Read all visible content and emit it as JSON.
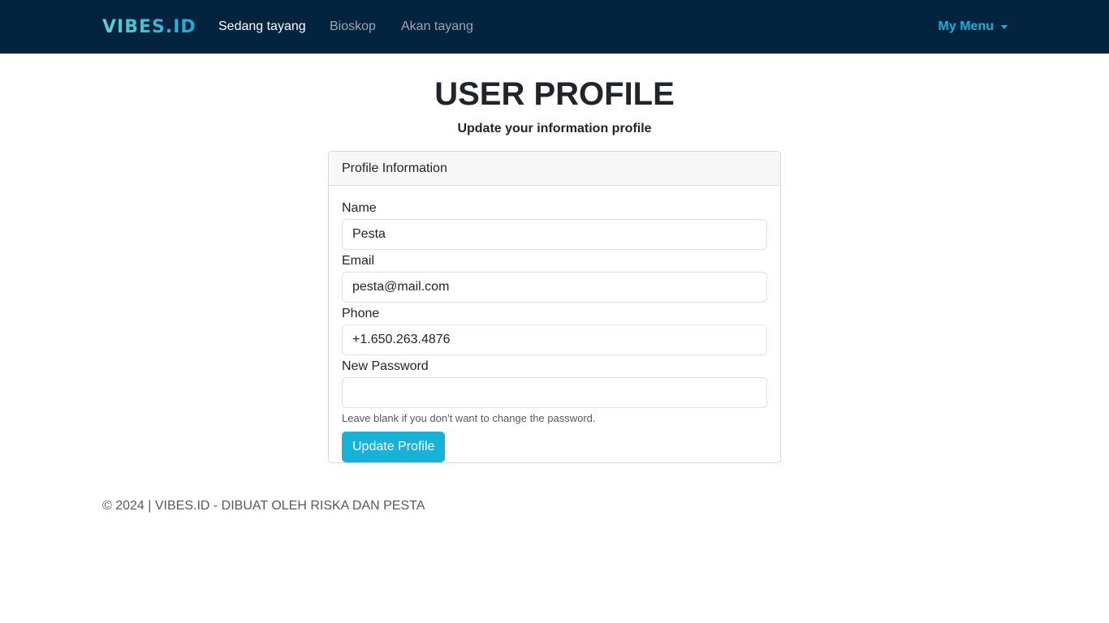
{
  "navbar": {
    "brand": "VIBES.ID",
    "links": [
      {
        "label": "Sedang tayang",
        "active": true
      },
      {
        "label": "Bioskop",
        "active": false
      },
      {
        "label": "Akan tayang",
        "active": false
      }
    ],
    "menu_label": "My Menu"
  },
  "page": {
    "title": "USER PROFILE",
    "subtitle": "Update your information profile"
  },
  "card": {
    "header": "Profile Information",
    "fields": {
      "name": {
        "label": "Name",
        "value": "Pesta"
      },
      "email": {
        "label": "Email",
        "value": "pesta@mail.com"
      },
      "phone": {
        "label": "Phone",
        "value": "+1.650.263.4876"
      },
      "password": {
        "label": "New Password",
        "value": ""
      }
    },
    "password_help": "Leave blank if you don't want to change the password.",
    "submit_label": "Update Profile"
  },
  "footer": {
    "text": "© 2024 | VIBES.ID - DIBUAT OLEH RISKA DAN PESTA"
  },
  "colors": {
    "navbar_bg": "#03233f",
    "accent": "#17b2d8",
    "brand_gradient_start": "#5fd3c3",
    "brand_gradient_end": "#23a6d5"
  }
}
